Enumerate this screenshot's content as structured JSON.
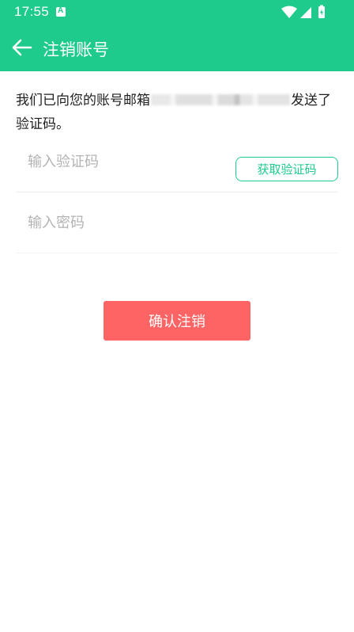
{
  "status_bar": {
    "time": "17:55",
    "app_icon": "a-app-notification-icon",
    "icons": [
      "wifi-icon",
      "cellular-signal-icon",
      "battery-charging-icon"
    ]
  },
  "app_bar": {
    "title": "注销账号",
    "back_icon": "arrow-left-icon",
    "background": "#1ecb8c"
  },
  "notice": {
    "prefix": "我们已向您的账号邮箱",
    "suffix": "发送了验证码。"
  },
  "code_field": {
    "placeholder": "输入验证码",
    "value": ""
  },
  "get_code_button": {
    "label": "获取验证码",
    "color": "#1ecb8c"
  },
  "password_field": {
    "placeholder": "输入密码",
    "value": ""
  },
  "confirm_button": {
    "label": "确认注销",
    "color": "#ff6464"
  }
}
